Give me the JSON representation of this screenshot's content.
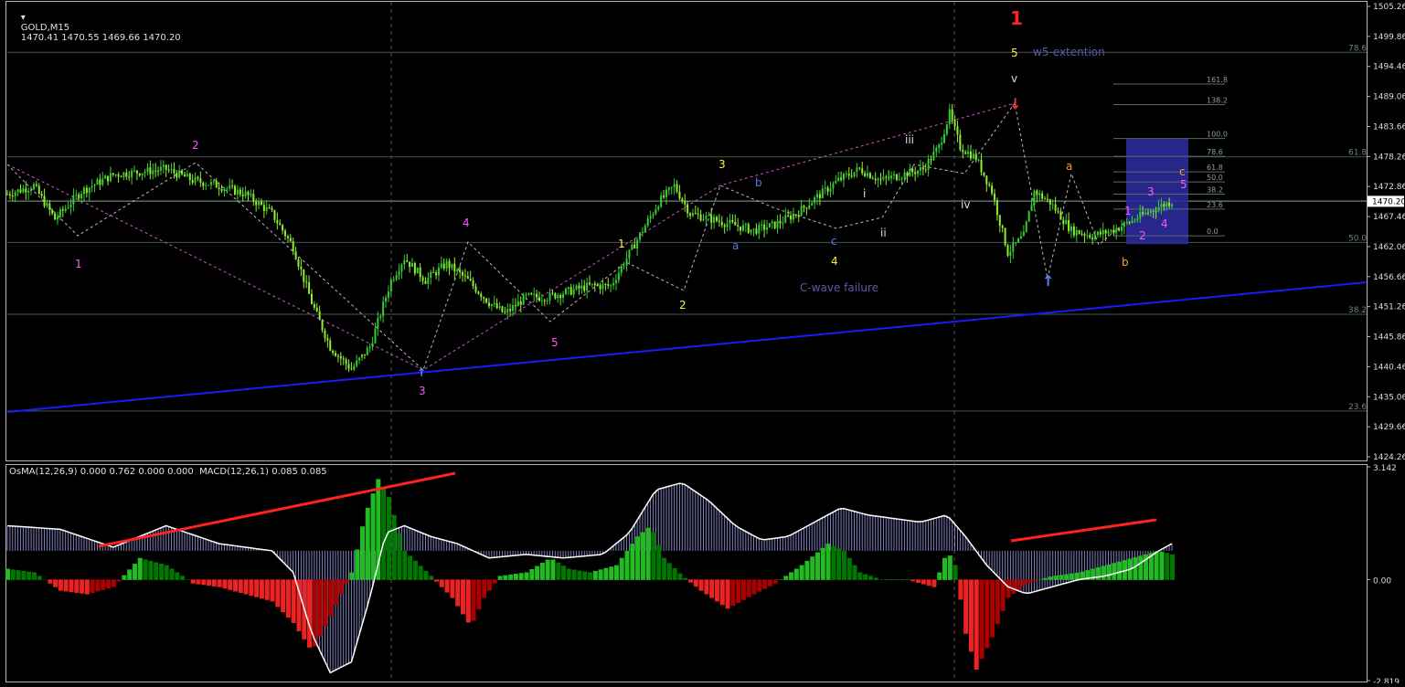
{
  "header": {
    "symbol": "GOLD,M15",
    "ohlc": "1470.41 1470.55 1469.66 1470.20",
    "indicator": "OsMA(12,26,9) 0.000 0.762 0.000 0.000  MACD(12,26,1) 0.085 0.085"
  },
  "colors": {
    "background": "#000000",
    "frame": "#b4b4b4",
    "grid_dashed": "#555555",
    "fib_line": "#3e5a4a",
    "price_bull": "#33cc33",
    "price_bear": "#90ee30",
    "trend_line": "#1a1aff",
    "macd_up": "#22bb22",
    "macd_dn": "#ee2222",
    "macd_up_dark": "#007700",
    "macd_dn_dark": "#aa0000",
    "signal_line": "#ffffff",
    "osma_hist": "#aaaaff",
    "divergence": "#ff2222",
    "fib_box": "#2a2a9a"
  },
  "chart_data": [
    {
      "type": "candlestick",
      "symbol": "GOLD",
      "timeframe": "M15",
      "ylim": [
        1424.26,
        1505.26
      ],
      "y_ticks": [
        "1505.26",
        "1499.86",
        "1494.46",
        "1489.06",
        "1483.66",
        "1478.26",
        "1472.86",
        "1467.46",
        "1462.06",
        "1456.66",
        "1451.26",
        "1445.86",
        "1440.46",
        "1435.06",
        "1429.66",
        "1424.26"
      ],
      "current_price": "1470.20",
      "price_path_approx": [
        [
          0,
          1471.5
        ],
        [
          10,
          1473
        ],
        [
          18,
          1467
        ],
        [
          28,
          1472
        ],
        [
          40,
          1475
        ],
        [
          60,
          1476
        ],
        [
          70,
          1474
        ],
        [
          80,
          1473
        ],
        [
          90,
          1471.5
        ],
        [
          100,
          1468
        ],
        [
          108,
          1462
        ],
        [
          115,
          1452
        ],
        [
          122,
          1444
        ],
        [
          130,
          1440
        ],
        [
          137,
          1444
        ],
        [
          145,
          1456
        ],
        [
          150,
          1460
        ],
        [
          158,
          1456
        ],
        [
          166,
          1459
        ],
        [
          174,
          1456
        ],
        [
          182,
          1452
        ],
        [
          188,
          1450
        ],
        [
          196,
          1453
        ],
        [
          204,
          1453
        ],
        [
          212,
          1454
        ],
        [
          220,
          1455
        ],
        [
          228,
          1455
        ],
        [
          234,
          1460
        ],
        [
          240,
          1465
        ],
        [
          246,
          1470
        ],
        [
          252,
          1473
        ],
        [
          258,
          1468
        ],
        [
          266,
          1467
        ],
        [
          274,
          1466
        ],
        [
          282,
          1465
        ],
        [
          290,
          1466
        ],
        [
          298,
          1468
        ],
        [
          306,
          1471
        ],
        [
          314,
          1474
        ],
        [
          322,
          1476
        ],
        [
          330,
          1474
        ],
        [
          338,
          1475
        ],
        [
          346,
          1476
        ],
        [
          352,
          1480
        ],
        [
          356,
          1486
        ],
        [
          360,
          1480
        ],
        [
          366,
          1478
        ],
        [
          372,
          1472
        ],
        [
          378,
          1461
        ],
        [
          384,
          1464
        ],
        [
          388,
          1472
        ],
        [
          394,
          1470
        ],
        [
          402,
          1465
        ],
        [
          410,
          1464
        ],
        [
          418,
          1465
        ],
        [
          426,
          1467
        ],
        [
          434,
          1469
        ],
        [
          440,
          1470.2
        ]
      ],
      "annotations": [
        {
          "text": "1",
          "color": "#ff55ff"
        },
        {
          "text": "2",
          "color": "#ff55ff"
        },
        {
          "text": "3",
          "color": "#ff55ff"
        },
        {
          "text": "4",
          "color": "#ff55ff"
        },
        {
          "text": "5",
          "color": "#ff55ff"
        },
        {
          "text": "1",
          "color": "#ffee33"
        },
        {
          "text": "2",
          "color": "#ffee33"
        },
        {
          "text": "3",
          "color": "#ffee33"
        },
        {
          "text": "4",
          "color": "#ffee33"
        },
        {
          "text": "5",
          "color": "#ffee33"
        },
        {
          "text": "a",
          "color": "#5577ee"
        },
        {
          "text": "b",
          "color": "#5577ee"
        },
        {
          "text": "c",
          "color": "#5577ee"
        },
        {
          "text": "i",
          "color": "#dddddd"
        },
        {
          "text": "ii",
          "color": "#dddddd"
        },
        {
          "text": "iii",
          "color": "#dddddd"
        },
        {
          "text": "iv",
          "color": "#dddddd"
        },
        {
          "text": "v",
          "color": "#dddddd"
        },
        {
          "text": "1",
          "color": "#ff2222"
        },
        {
          "text": "a",
          "color": "#ff9922"
        },
        {
          "text": "b",
          "color": "#ff9922"
        },
        {
          "text": "c",
          "color": "#ff9922"
        },
        {
          "text": "1",
          "color": "#ff55ff"
        },
        {
          "text": "2",
          "color": "#ff55ff"
        },
        {
          "text": "3",
          "color": "#ff55ff"
        },
        {
          "text": "4",
          "color": "#ff55ff"
        },
        {
          "text": "5",
          "color": "#ff55ff"
        },
        {
          "text": "C-wave failure",
          "color": "#5a5aaa"
        },
        {
          "text": "w5-extention",
          "color": "#5a5aaa"
        }
      ],
      "fib_levels_right": [
        "78.6",
        "61.8",
        "50.0",
        "38.2",
        "23.6"
      ],
      "fib_levels_box": [
        "161.8",
        "138.2",
        "100.0",
        "78.6",
        "61.8",
        "50.0",
        "38.2",
        "23.6",
        "0.0"
      ]
    },
    {
      "type": "bar",
      "name": "OsMA / MACD",
      "ylim": [
        -2.819,
        3.142
      ],
      "y_ticks": [
        "3.142",
        "0.00",
        "-2.819"
      ]
    }
  ]
}
